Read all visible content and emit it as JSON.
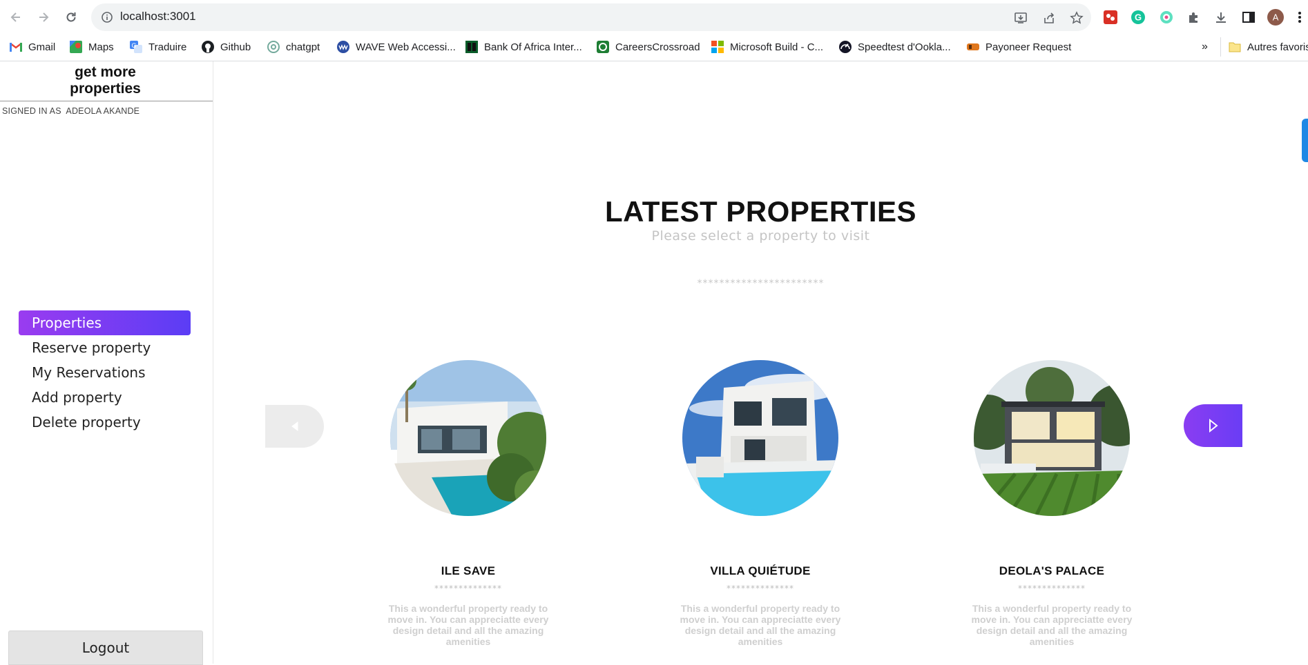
{
  "browser": {
    "url": "localhost:3001",
    "profile_initial": "A",
    "bookmarks": [
      {
        "label": "Gmail",
        "icon": "gmail-icon"
      },
      {
        "label": "Maps",
        "icon": "maps-icon"
      },
      {
        "label": "Traduire",
        "icon": "translate-icon"
      },
      {
        "label": "Github",
        "icon": "github-icon"
      },
      {
        "label": "chatgpt",
        "icon": "chatgpt-icon"
      },
      {
        "label": "WAVE Web Accessi...",
        "icon": "wave-icon"
      },
      {
        "label": "Bank Of Africa Inter...",
        "icon": "bank-icon"
      },
      {
        "label": "CareersCrossroad",
        "icon": "careers-icon"
      },
      {
        "label": "Microsoft Build - C...",
        "icon": "microsoft-icon"
      },
      {
        "label": "Speedtest d'Ookla...",
        "icon": "speedtest-icon"
      },
      {
        "label": "Payoneer Request",
        "icon": "payoneer-icon"
      }
    ],
    "overflow_label": "»",
    "other_bookmarks": "Autres favoris"
  },
  "sidebar": {
    "logo": "get more properties",
    "signed_in": "SIGNED IN AS  ADEOLA AKANDE",
    "menu": [
      {
        "label": "Properties",
        "active": true
      },
      {
        "label": "Reserve property",
        "active": false
      },
      {
        "label": "My Reservations",
        "active": false
      },
      {
        "label": "Add property",
        "active": false
      },
      {
        "label": "Delete property",
        "active": false
      }
    ],
    "logout": "Logout"
  },
  "main": {
    "title": "LATEST PROPERTIES",
    "subtitle": "Please select a property to visit",
    "divider": "***********************",
    "properties": [
      {
        "name": "ILE SAVE",
        "stars": "**************",
        "description": "This a wonderful property ready to move in. You can appreciatte every design detail and all the amazing amenities"
      },
      {
        "name": "VILLA QUIÉTUDE",
        "stars": "**************",
        "description": "This a wonderful property ready to move in. You can appreciatte every design detail and all the amazing amenities"
      },
      {
        "name": "DEOLA'S PALACE",
        "stars": "**************",
        "description": "This a wonderful property ready to move in. You can appreciatte every design detail and all the amazing amenities"
      }
    ]
  },
  "colors": {
    "accent_start": "#9a3cf0",
    "accent_end": "#5b3df5",
    "muted_text": "#c4c4c4"
  }
}
